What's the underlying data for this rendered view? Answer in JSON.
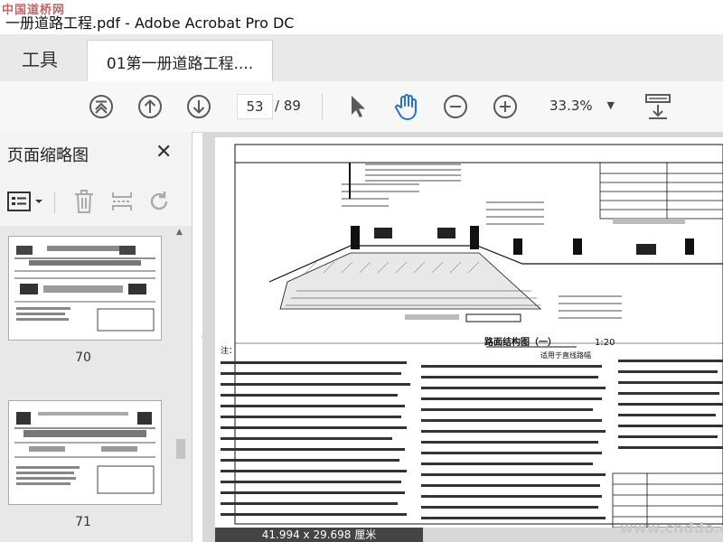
{
  "app": {
    "window_title": "一册道路工程.pdf - Adobe Acrobat Pro DC",
    "watermark_top": "中国道桥网",
    "watermark_bottom": "www.cnddo.com"
  },
  "tabs": {
    "tools_label": "工具",
    "document_label": "01第一册道路工程...."
  },
  "toolbar": {
    "current_page": "53",
    "total_pages": "/ 89",
    "zoom": "33.3%"
  },
  "sidebar": {
    "title": "页面缩略图",
    "thumbnails": [
      {
        "page_label": "70"
      },
      {
        "page_label": "71"
      }
    ]
  },
  "document": {
    "page_size": "41.994 x 29.698 厘米",
    "section_title": "路面结构图（一）",
    "scale": "1:20",
    "subtitle": "适用于直线路幅",
    "notes_heading": "注："
  },
  "colors": {
    "accent": "#2b6fd6",
    "icon_gray": "#5a5a5a"
  }
}
